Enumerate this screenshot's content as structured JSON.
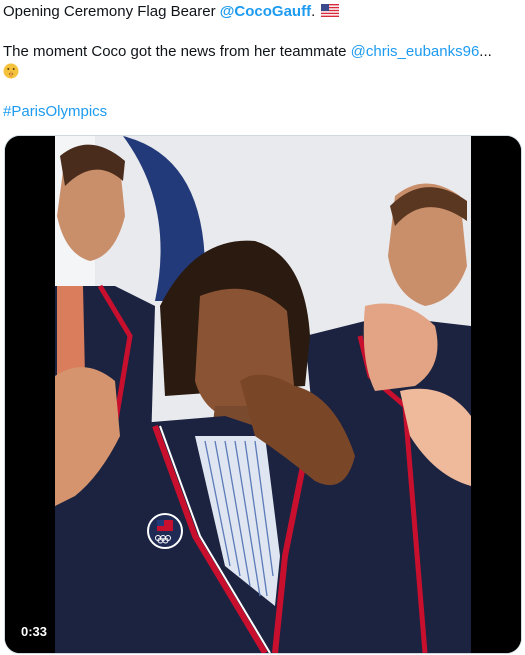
{
  "tweet": {
    "line1_prefix": "Opening Ceremony Flag Bearer ",
    "mention_primary": "@CocoGauff",
    "line1_suffix": ".",
    "flag_emoji": "us-flag",
    "line2_prefix": "The moment Coco got the news from her teammate ",
    "mention_secondary": "@chris_eubanks96",
    "line2_suffix": "...",
    "emoji": "shushing-face",
    "hashtag": "#ParisOlympics"
  },
  "video": {
    "timestamp": "0:33",
    "badge_text": "UNITED STATES OLYMPIC TEAM"
  },
  "colors": {
    "link": "#1d9bf0",
    "blazer": "#1b2340",
    "trim_red": "#c8102e",
    "backdrop": "#e9eaee"
  }
}
